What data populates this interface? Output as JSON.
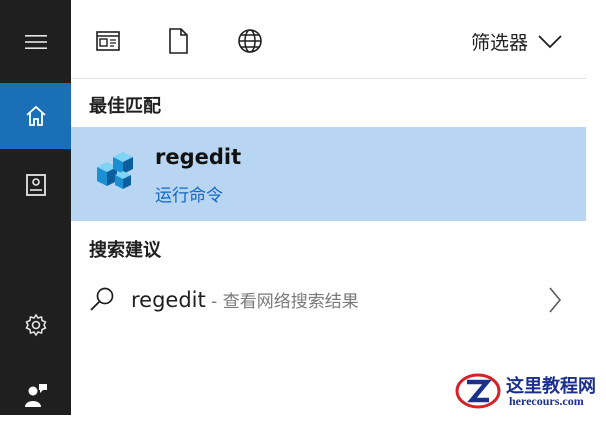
{
  "rail": {
    "items": [
      {
        "name": "menu",
        "icon": "hamburger-icon"
      },
      {
        "name": "home",
        "icon": "home-icon",
        "active": true
      },
      {
        "name": "notebook",
        "icon": "notebook-icon"
      },
      {
        "name": "settings",
        "icon": "gear-icon"
      },
      {
        "name": "feedback",
        "icon": "feedback-icon"
      }
    ]
  },
  "toolbar": {
    "icons": [
      "apps-icon",
      "document-icon",
      "web-icon"
    ],
    "filter_label": "筛选器"
  },
  "best_match": {
    "heading": "最佳匹配",
    "app_name": "regedit",
    "app_subtitle": "运行命令",
    "icon": "registry-editor-icon"
  },
  "suggestions": {
    "heading": "搜索建议",
    "items": [
      {
        "query": "regedit",
        "suffix": " - 查看网络搜索结果"
      }
    ]
  },
  "watermark": {
    "title": "这里教程网",
    "url": "herecours.com"
  },
  "colors": {
    "rail_bg": "#1f1f1f",
    "rail_active": "#1a6fb6",
    "best_match_bg": "#b8d6f1",
    "link_blue": "#1166c6"
  }
}
